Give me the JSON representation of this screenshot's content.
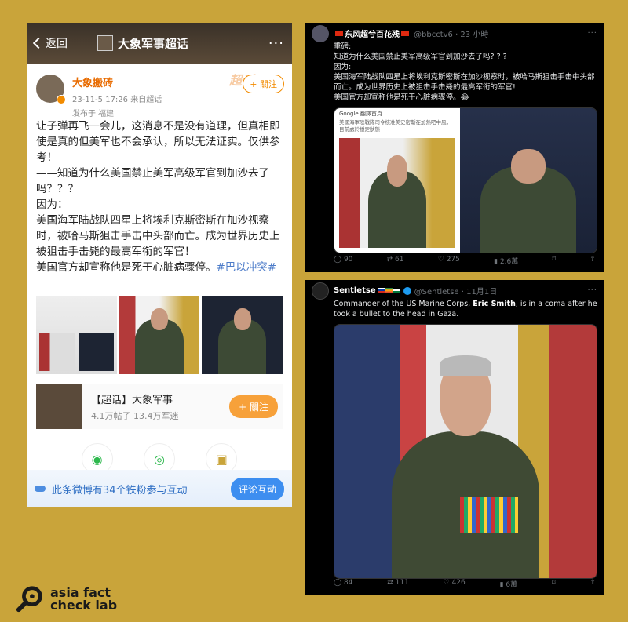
{
  "weibo": {
    "back_label": "返回",
    "title": "大象军事超话",
    "more": "···",
    "user": {
      "name": "大象搬砖",
      "time_source": "23-11-5 17:26  来自超话",
      "location": "发布于 福建",
      "follow_label": "+ 關注",
      "watermark": "超话"
    },
    "text_lines": [
      "让子弹再飞一会儿，这消息不是没有道理，但真相即使是真的但美军也不会承认，所以无法证实。仅供参考！",
      "——知道为什么美国禁止美军高级军官到加沙去了吗？？？",
      "因为：",
      "美国海军陆战队四星上将埃利克斯密斯在加沙视察时，被哈马斯狙击手击中头部而亡。成为世界历史上被狙击手击毙的最高军衔的军官！",
      "美国官方却宣称他是死于心脏病骤停。"
    ],
    "hashtag": "#巴以冲突#",
    "topic": {
      "name": "【超话】大象军事",
      "stats": "4.1万帖子  13.4万军迷",
      "follow_label": "+ 關注"
    },
    "bottom": {
      "text": "此条微博有34个铁粉参与互动",
      "button": "评论互动"
    }
  },
  "tweet1": {
    "name": "东风超兮百花残",
    "handle": "@bbcctv6 · 23 小時",
    "lines": [
      "重磅:",
      "知道为什么美国禁止美军高级军官到加沙去了吗? ? ?",
      "因为:",
      "美国海军陆战队四星上将埃利克斯密斯在加沙视察时，被哈马斯狙击手击中头部而亡。成为世界历史上被狙击手击毙的最高军衔的军官!",
      "美国官方却宣称他是死于心脏病骤停。😂"
    ],
    "shot_bar": "Google 翻譯首頁",
    "shot_text": "美國海軍陸戰隊司令核准美史密斯在加熱吧中風，目前處於穩定狀態",
    "actions": {
      "reply": "90",
      "retweet": "61",
      "like": "275",
      "views": "2.6萬"
    }
  },
  "tweet2": {
    "name": "Sentletse",
    "handle": "@Sentletse · 11月1日",
    "text_before": "Commander of the US Marine Corps, ",
    "text_bold": "Eric Smith",
    "text_after": ", is in a coma after he took a bullet to the head in Gaza.",
    "actions": {
      "reply": "84",
      "retweet": "111",
      "like": "426",
      "views": "6萬"
    }
  },
  "logo": {
    "line1": "asia fact",
    "line2": "check lab"
  },
  "colors": {
    "background": "#c9a43a",
    "weibo_orange": "#f28b00",
    "twitter_blue": "#1d9bf0"
  }
}
